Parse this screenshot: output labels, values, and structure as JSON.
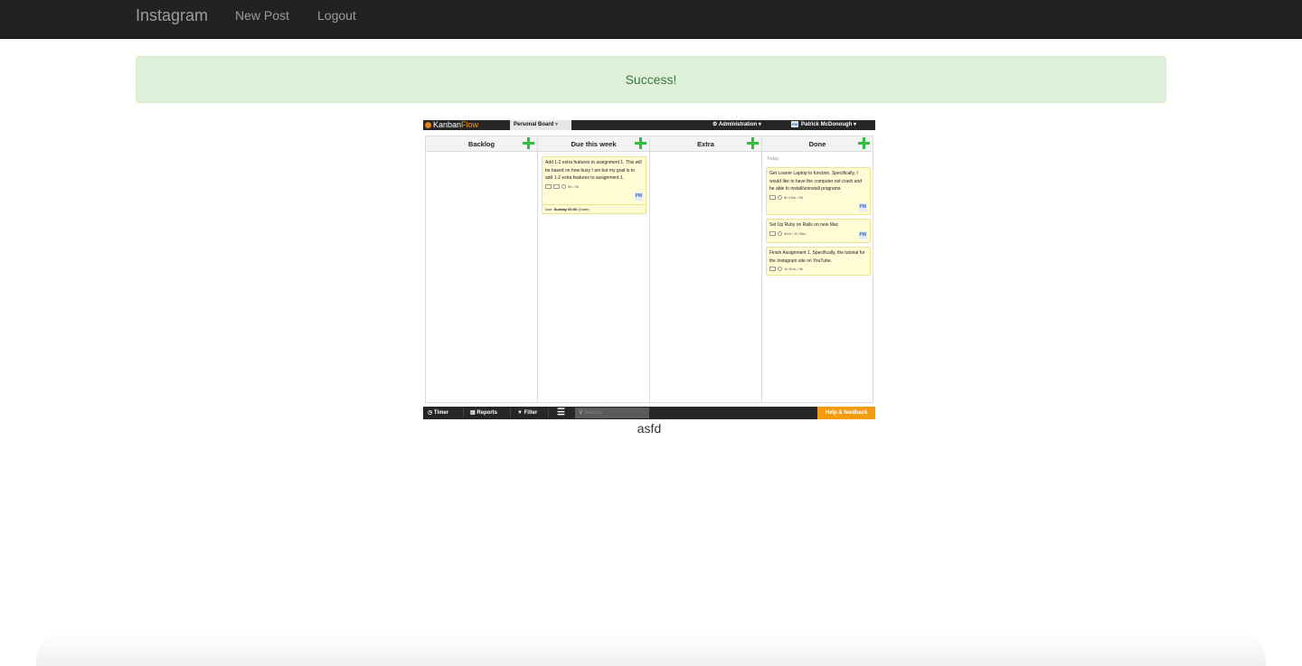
{
  "navbar": {
    "brand": "Instagram",
    "links": [
      "New Post",
      "Logout"
    ]
  },
  "alert": {
    "message": "Success!"
  },
  "post": {
    "caption": "asfd",
    "image": {
      "app_logo_prefix": "Kanban",
      "app_logo_suffix": "Flow",
      "board_tab": "Personal Board",
      "admin_menu": "Administration",
      "user_menu": "Patrick McDonough",
      "user_initials": "PM",
      "columns": [
        {
          "title": "Backlog"
        },
        {
          "title": "Due this week"
        },
        {
          "title": "Extra"
        },
        {
          "title": "Done"
        }
      ],
      "done_group_label": "Today",
      "cards": [
        {
          "text": "Add 1-2 extra features to assignment 1. This will be based on how busy I am but my goal is to add 1-2 extra features to assignment 1.",
          "time": "0h / 2h",
          "owner": "PM",
          "due_prefix": "Due:",
          "due_value": "Sunday 00:00",
          "due_suffix": "(Done)"
        },
        {
          "text": "Get Loaner Laptop to function. Specifically, I would like to have the computer not crash and be able to install/uninstall programs.",
          "time": "8h 10m / 9h",
          "owner": "PM"
        },
        {
          "text": "Set Up Ruby on Rails on new Mac",
          "time": "30m / 2h 30m",
          "owner": "PM"
        },
        {
          "text": "Finish Assignment 1. Specifically, the tutorial for the Instagram site on YouTube.",
          "time": "1h 51m / 3h"
        }
      ],
      "bottom_bar": {
        "timer": "Timer",
        "reports": "Reports",
        "filter": "Filter",
        "search_placeholder": "Search",
        "help": "Help & feedback"
      }
    }
  },
  "colors": {
    "navbar_bg": "#222222",
    "nav_text": "#9d9d9d",
    "alert_bg": "#dff0d8",
    "alert_text": "#3c763d",
    "kanban_plus": "#2ebd3f",
    "kanban_card": "#fefbd5",
    "kanban_help": "#f39c12"
  }
}
